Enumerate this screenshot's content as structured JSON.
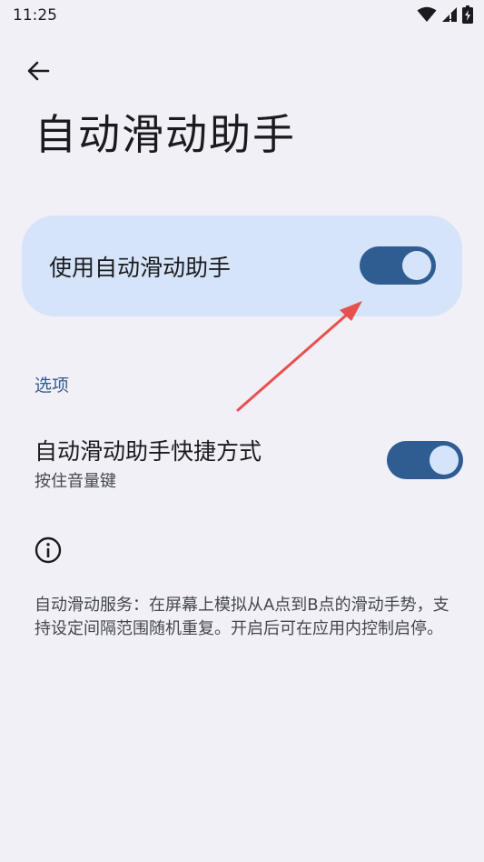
{
  "status_bar": {
    "time": "11:25",
    "icons": [
      "wifi-icon",
      "cellular-signal-icon",
      "battery-charging-icon"
    ]
  },
  "header": {
    "back_icon": "arrow-back-icon",
    "title": "自动滑动助手"
  },
  "main_toggle": {
    "label": "使用自动滑动助手",
    "enabled": true
  },
  "options": {
    "section_title": "选项",
    "shortcut": {
      "title": "自动滑动助手快捷方式",
      "summary": "按住音量键",
      "enabled": true
    }
  },
  "info": {
    "icon": "info-icon",
    "text": "自动滑动服务：在屏幕上模拟从A点到B点的滑动手势，支持设定间隔范围随机重复。开启后可在应用内控制启停。"
  },
  "colors": {
    "background": "#F2F0F7",
    "card": "#D5E4F8",
    "accent": "#2F5D92",
    "annotation_arrow": "#E8504E"
  }
}
